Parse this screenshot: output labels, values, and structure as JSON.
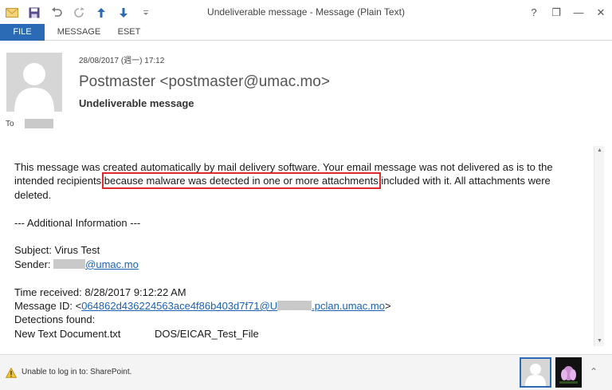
{
  "window": {
    "title": "Undeliverable message - Message (Plain Text)",
    "controls": {
      "help": "?",
      "restore": "❐",
      "minimize": "—",
      "close": "✕"
    }
  },
  "quick_access": {
    "icons": [
      "mail-icon",
      "save-icon",
      "undo-icon",
      "redo-icon",
      "up-arrow-icon",
      "down-arrow-icon",
      "customize-icon"
    ]
  },
  "ribbon": {
    "tabs": [
      "FILE",
      "MESSAGE",
      "ESET"
    ]
  },
  "header": {
    "date": "28/08/2017 (週一) 17:12",
    "sender": "Postmaster <postmaster@umac.mo>",
    "subject": "Undeliverable message",
    "to_label": "To"
  },
  "body": {
    "line1_a": "This message was created automatically by mail delivery software. Your email message was not delivered as is to the",
    "line2_a": "intended recipients ",
    "line2_highlight": "because malware was detected in one or more attachments",
    "line2_b": " included with it. All attachments were",
    "line3": "deleted.",
    "additional_info": "--- Additional Information ---",
    "subject_line": "Subject: Virus Test",
    "sender_label": "Sender: ",
    "sender_domain": "@umac.mo",
    "time_received": "Time received: 8/28/2017 9:12:22 AM",
    "message_id_label": "Message ID: <",
    "message_id_link_a": "064862d436224563ace4f86b403d7f71@U",
    "message_id_link_b": ".pclan.umac.mo",
    "message_id_end": ">",
    "detections_found": "Detections found:",
    "detection_file": "New Text Document.txt",
    "detection_name": "DOS/EICAR_Test_File"
  },
  "statusbar": {
    "text": "Unable to log in to: SharePoint."
  },
  "colors": {
    "accent": "#2b6bb5",
    "highlight_box": "#e0292a",
    "link": "#1b61b7"
  }
}
